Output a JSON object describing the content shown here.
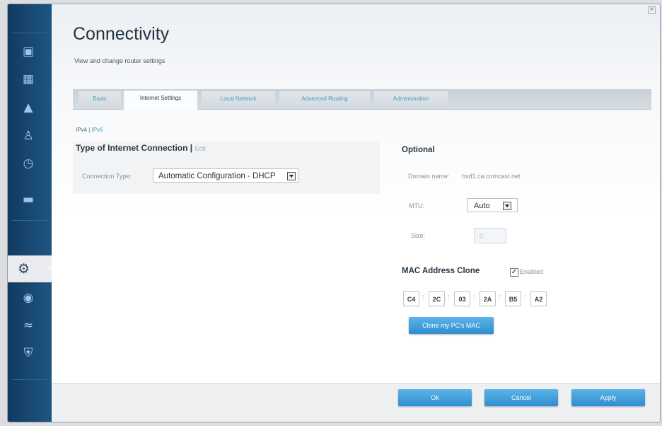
{
  "page": {
    "title": "Connectivity",
    "subtitle": "View and change router settings"
  },
  "sidebar": {
    "icons": [
      "devices-icon",
      "router-icon",
      "alert-icon",
      "parental-controls-icon",
      "clock-icon",
      "speed-test-icon",
      "settings-icon",
      "camera-icon",
      "wifi-icon",
      "security-icon"
    ],
    "active": "settings-icon"
  },
  "tabs": [
    {
      "label": "Basic",
      "active": false
    },
    {
      "label": "Internet Settings",
      "active": true
    },
    {
      "label": "Local Network",
      "active": false
    },
    {
      "label": "Advanced Routing",
      "active": false
    },
    {
      "label": "Administration",
      "active": false
    }
  ],
  "ip_version": {
    "ipv4": "IPv4",
    "separator": "|",
    "ipv6": "IPv6",
    "selected": "IPv6"
  },
  "connection": {
    "heading": "Type of Internet Connection",
    "separator": "|",
    "edit_label": "Edit",
    "type_label": "Connection Type:",
    "type_value": "Automatic Configuration - DHCP"
  },
  "optional": {
    "heading": "Optional",
    "domain_label": "Domain name:",
    "domain_value": "hsd1.ca.comcast.net",
    "mtu_label": "MTU:",
    "mtu_value": "Auto",
    "size_label": "Size:",
    "size_value": "0"
  },
  "mac_clone": {
    "heading": "MAC Address Clone",
    "enabled_label": "Enabled",
    "enabled_checked": true,
    "octets": [
      "C4",
      "2C",
      "03",
      "2A",
      "B5",
      "A2"
    ],
    "separator": ":",
    "clone_button": "Clone my PC's MAC"
  },
  "footer": {
    "ok": "Ok",
    "cancel": "Cancel",
    "apply": "Apply"
  },
  "colors": {
    "sidebar": "#1d5683",
    "accent": "#2f8ed0",
    "tab_link": "#4f9ac2"
  }
}
